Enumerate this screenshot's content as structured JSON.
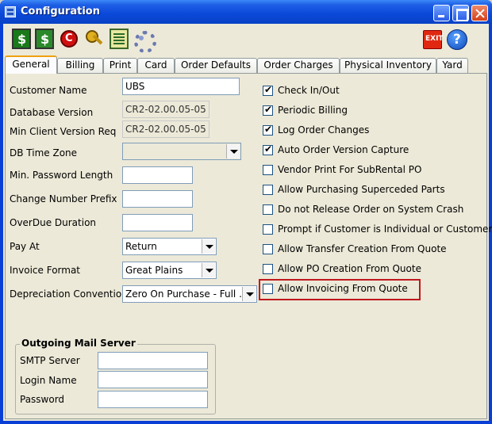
{
  "window": {
    "title": "Configuration"
  },
  "toolbar": {
    "exit_label": "EXIT",
    "help_label": "?"
  },
  "tabs": [
    {
      "label": "General",
      "active": true
    },
    {
      "label": "Billing"
    },
    {
      "label": "Print"
    },
    {
      "label": "Card"
    },
    {
      "label": "Order Defaults"
    },
    {
      "label": "Order  Charges"
    },
    {
      "label": "Physical Inventory"
    },
    {
      "label": "Yard"
    }
  ],
  "fields": {
    "customer_name": {
      "label": "Customer Name",
      "value": "UBS"
    },
    "database_version": {
      "label": "Database Version",
      "value": "CR2-02.00.05-05"
    },
    "min_client_version": {
      "label": "Min Client Version Req",
      "value": "CR2-02.00.05-05"
    },
    "db_time_zone": {
      "label": "DB Time Zone",
      "value": ""
    },
    "min_password_length": {
      "label": "Min. Password Length",
      "value": ""
    },
    "change_number_prefix": {
      "label": "Change Number Prefix",
      "value": ""
    },
    "overdue_duration": {
      "label": "OverDue Duration",
      "value": ""
    },
    "pay_at": {
      "label": "Pay At",
      "value": "Return"
    },
    "invoice_format": {
      "label": "Invoice Format",
      "value": "Great Plains"
    },
    "depreciation_convention": {
      "label": "Depreciation Convention",
      "value": "Zero On Purchase - Full ..."
    }
  },
  "mail_server": {
    "title": "Outgoing Mail Server",
    "smtp_label": "SMTP Server",
    "smtp_value": "",
    "login_label": "Login Name",
    "login_value": "",
    "password_label": "Password",
    "password_value": ""
  },
  "options": [
    {
      "label": "Check In/Out",
      "checked": true
    },
    {
      "label": "Periodic Billing",
      "checked": true
    },
    {
      "label": "Log Order Changes",
      "checked": true
    },
    {
      "label": "Auto Order Version Capture",
      "checked": true
    },
    {
      "label": "Vendor Print For SubRental PO",
      "checked": false
    },
    {
      "label": "Allow Purchasing Superceded Parts",
      "checked": false
    },
    {
      "label": "Do not Release Order on System Crash",
      "checked": false
    },
    {
      "label": "Prompt if Customer is Individual or Customer",
      "checked": false
    },
    {
      "label": "Allow Transfer Creation From Quote",
      "checked": false
    },
    {
      "label": "Allow PO Creation From Quote",
      "checked": false
    },
    {
      "label": "Allow Invoicing From Quote",
      "checked": false
    }
  ],
  "colors": {
    "highlight": "#c0181e",
    "title_bar": "#0a48d8"
  }
}
